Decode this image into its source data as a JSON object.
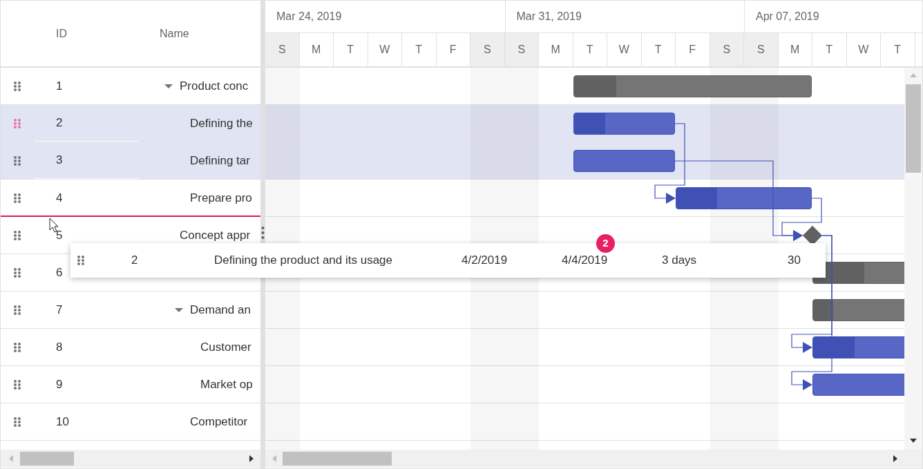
{
  "grid": {
    "columns": [
      "ID",
      "Name"
    ]
  },
  "timeline": {
    "weeks": [
      "Mar 24, 2019",
      "Mar 31, 2019",
      "Apr 07, 2019"
    ],
    "days": [
      {
        "label": "S",
        "weekend": true
      },
      {
        "label": "M",
        "weekend": false
      },
      {
        "label": "T",
        "weekend": false
      },
      {
        "label": "W",
        "weekend": false
      },
      {
        "label": "T",
        "weekend": false
      },
      {
        "label": "F",
        "weekend": false
      },
      {
        "label": "S",
        "weekend": true
      },
      {
        "label": "S",
        "weekend": true
      },
      {
        "label": "M",
        "weekend": false
      },
      {
        "label": "T",
        "weekend": false
      },
      {
        "label": "W",
        "weekend": false
      },
      {
        "label": "T",
        "weekend": false
      },
      {
        "label": "F",
        "weekend": false
      },
      {
        "label": "S",
        "weekend": true
      },
      {
        "label": "S",
        "weekend": true
      },
      {
        "label": "M",
        "weekend": false
      },
      {
        "label": "T",
        "weekend": false
      },
      {
        "label": "W",
        "weekend": false
      },
      {
        "label": "T",
        "weekend": false
      }
    ]
  },
  "tasks": [
    {
      "no": "1",
      "name": "Product conc",
      "expanded": true,
      "selected": false,
      "drag_source": false,
      "drop_above": false,
      "bar": {
        "kind": "summary",
        "level": 0.18
      },
      "children": [
        {
          "no": "2",
          "name": "Defining the",
          "selected": true,
          "drag_source": true,
          "drop_above": false,
          "bar": {
            "kind": "task",
            "level": 0.31
          }
        },
        {
          "no": "3",
          "name": "Defining tar",
          "selected": true,
          "drag_source": false,
          "drop_above": false,
          "bar": {
            "kind": "task",
            "level": 0
          }
        },
        {
          "no": "4",
          "name": "Prepare pro",
          "selected": false,
          "drag_source": false,
          "drop_above": false,
          "bar": {
            "kind": "task",
            "level": 0.3
          }
        }
      ]
    },
    {
      "no": "5",
      "name": "Concept appr",
      "selected": false,
      "drag_source": false,
      "drop_above": true,
      "bar": {
        "kind": "milestone"
      }
    },
    {
      "no": "6",
      "selected": false,
      "drag_source": false,
      "drop_above": false,
      "bar": {
        "kind": "summary",
        "level": 0.38
      },
      "children": [
        {
          "no": "7",
          "name": "Demand an",
          "expanded": true,
          "selected": false,
          "drag_source": false,
          "drop_above": false,
          "bar": {
            "kind": "summary",
            "level": 0.15
          },
          "children": [
            {
              "no": "8",
              "name": "Customer",
              "selected": false,
              "drag_source": false,
              "drop_above": false,
              "bar": {
                "kind": "task",
                "level": 0.31
              }
            },
            {
              "no": "9",
              "name": "Market op",
              "selected": false,
              "drag_source": false,
              "drop_above": false,
              "bar": {
                "kind": "task",
                "level": 0
              }
            }
          ]
        },
        {
          "no": "10",
          "name": "Competitor",
          "selected": false,
          "drag_source": false,
          "drop_above": false
        }
      ]
    }
  ],
  "drag_preview": {
    "task_no": "2",
    "name": "Defining the product and its usage",
    "start": "4/2/2019",
    "end": "4/4/2019",
    "duration": "3 days",
    "progress": "30",
    "count": "2"
  }
}
